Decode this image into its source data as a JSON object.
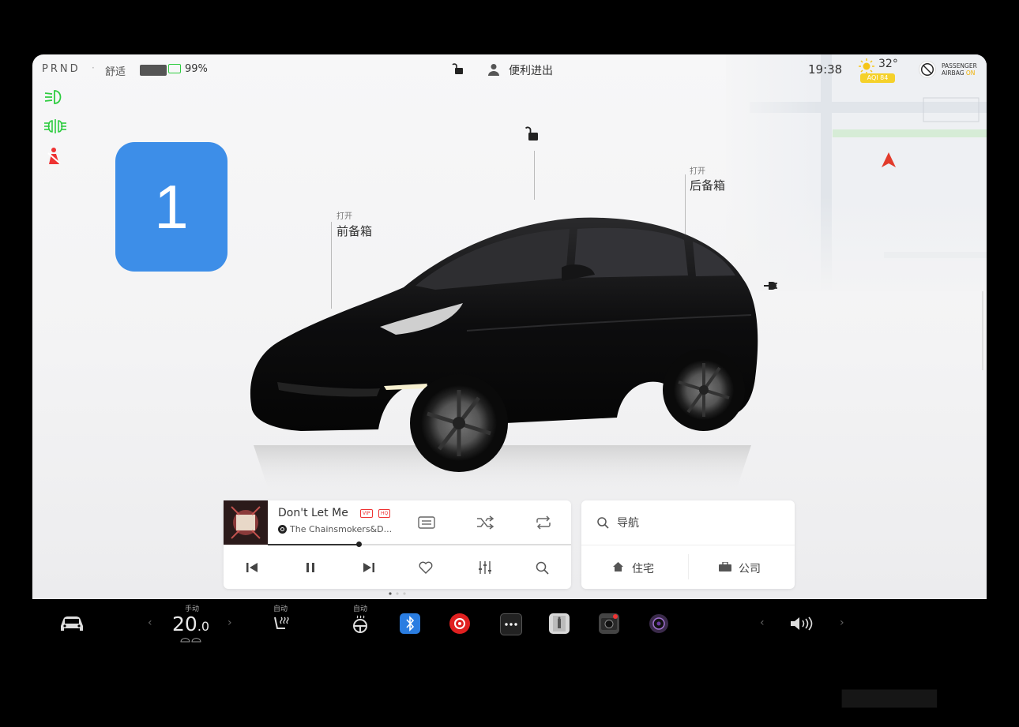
{
  "status_bar": {
    "gear": "PRND",
    "separator": "·",
    "drive_mode": "舒适",
    "battery_pct": "99%",
    "battery_level": 0.99,
    "user_label": "便利进出",
    "time": "19:38",
    "temperature": "32°",
    "aqi": "AQI 84",
    "airbag_line1": "PASSENGER",
    "airbag_line2": "AIRBAG",
    "airbag_state": "ON"
  },
  "badge": {
    "number": "1"
  },
  "callouts": {
    "frunk": {
      "action": "打开",
      "label": "前备箱"
    },
    "trunk": {
      "action": "打开",
      "label": "后备箱"
    }
  },
  "media": {
    "title": "Don't Let Me",
    "tag_vip": "VIP",
    "tag_hq": "HQ",
    "artist": "The Chainsmokers&D...",
    "progress": 0.3
  },
  "navigation": {
    "search_label": "导航",
    "home_label": "住宅",
    "work_label": "公司"
  },
  "taskbar": {
    "climate_mode": "手动",
    "temp_whole": "20",
    "temp_decimal": ".0",
    "seat_mode": "自动",
    "wheel_mode": "自动",
    "left_arrow": "‹",
    "right_arrow": "›"
  },
  "colors": {
    "accent_blue": "#3d8ee8",
    "indicator_green": "#2ecc40",
    "warning_red": "#e33",
    "nav_arrow": "#e23b2b"
  }
}
